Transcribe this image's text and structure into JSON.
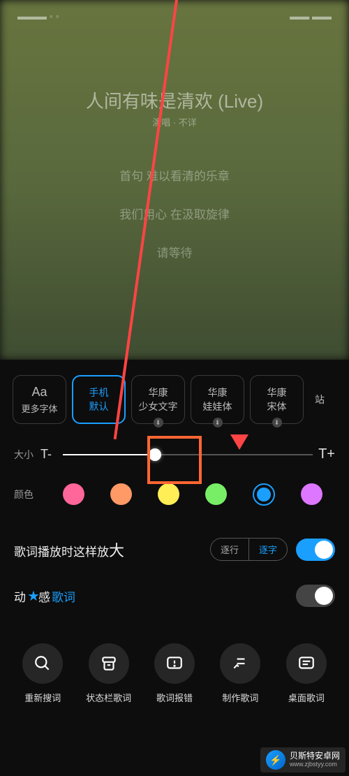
{
  "background": {
    "song_title": "人间有味是清欢 (Live)",
    "song_artist": "演唱 · 不详",
    "lyric1": "首句  难以看清的乐章",
    "lyric2": "我们用心  在汲取旋律",
    "lyric3": "请等待"
  },
  "fonts": {
    "more_icon": "Aa",
    "more_label": "更多字体",
    "options": [
      {
        "line1": "手机",
        "line2": "默认",
        "selected": true,
        "download": false
      },
      {
        "line1": "华康",
        "line2": "少女文字",
        "selected": false,
        "download": true
      },
      {
        "line1": "华康",
        "line2": "娃娃体",
        "selected": false,
        "download": true
      },
      {
        "line1": "华康",
        "line2": "宋体",
        "selected": false,
        "download": true
      }
    ],
    "last_partial": "站"
  },
  "size": {
    "label": "大小",
    "minus": "T-",
    "plus": "T+",
    "percent": 37
  },
  "colors": {
    "label": "颜色",
    "swatches": [
      {
        "hex": "#ff6699",
        "selected": false
      },
      {
        "hex": "#ff9966",
        "selected": false
      },
      {
        "hex": "#ffee55",
        "selected": false
      },
      {
        "hex": "#77ee66",
        "selected": false
      },
      {
        "hex": "#1a9fff",
        "selected": true
      },
      {
        "hex": "#dd77ff",
        "selected": false
      }
    ]
  },
  "zoom_option": {
    "label_prefix": "歌词播放时这样放",
    "label_big": "大",
    "pills": [
      "逐行",
      "逐字"
    ],
    "pill_active": 1,
    "toggle_on": true
  },
  "dynamic_option": {
    "label_1": "动",
    "label_star": "★",
    "label_2": "感",
    "label_3": "歌词",
    "toggle_on": false
  },
  "actions": [
    {
      "icon": "search",
      "label": "重新搜词"
    },
    {
      "icon": "archive",
      "label": "状态栏歌词"
    },
    {
      "icon": "alert",
      "label": "歌词报错"
    },
    {
      "icon": "edit",
      "label": "制作歌词"
    },
    {
      "icon": "desktop",
      "label": "桌面歌词"
    }
  ],
  "watermark": {
    "name": "贝斯特安卓网",
    "url": "www.zjbstyy.com"
  }
}
